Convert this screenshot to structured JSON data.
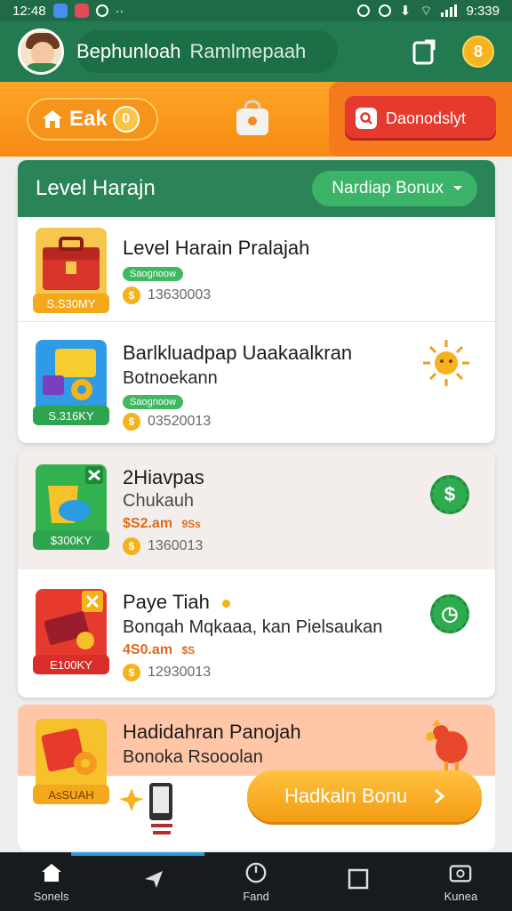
{
  "status_bar": {
    "time": "12:48",
    "right_time": "9:339"
  },
  "header": {
    "name_first": "Bephunloah",
    "name_second": "Ramlmepaah",
    "coin_label": "8"
  },
  "top_bar": {
    "left_label": "Eak",
    "left_badge": "0",
    "right_button": "Daonodslyt"
  },
  "panel": {
    "title": "Level Harajn",
    "dropdown_label": "Nardiap Bonux",
    "rows": [
      {
        "title": "Level Harain Pralajah",
        "chip": "Saognoow",
        "tag": "S.S30MY",
        "meta": "13630003"
      },
      {
        "title": "Barlkluadpap Uaakaalkran",
        "subtitle": "Botnoekann",
        "tag": "S.316KY",
        "meta": "03520013"
      }
    ]
  },
  "card2": {
    "rows": [
      {
        "title": "2Hiavpas",
        "subtitle": "Chukauh",
        "price": "$S2.am",
        "price_small": "9Ss",
        "tag": "$300KY",
        "meta": "1360013"
      },
      {
        "title": "Paye Tiah",
        "subtitle": "Bonqah Mqkaaa, kan Pielsaukan",
        "price": "4S0.am",
        "price_small": "$S",
        "tag": "E100KY",
        "meta": "12930013"
      }
    ]
  },
  "card3": {
    "title": "Hadidahran Panojah",
    "subtitle": "Bonoka Rsooolan",
    "tag": "AsSUAH",
    "cta": "Hadkaln Bonu"
  },
  "bottom_nav": [
    {
      "label": "Sonels"
    },
    {
      "label": ""
    },
    {
      "label": "Fand"
    },
    {
      "label": ""
    },
    {
      "label": "Kunea"
    }
  ]
}
